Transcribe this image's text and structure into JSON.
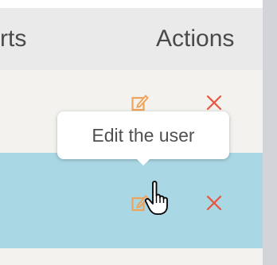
{
  "table": {
    "columns": [
      {
        "label": "rts"
      },
      {
        "label": "Actions"
      }
    ],
    "rows": [
      {
        "state": "normal",
        "actions": [
          "edit-icon",
          "delete-icon"
        ]
      },
      {
        "state": "hovered",
        "actions": [
          "edit-icon",
          "delete-icon"
        ]
      },
      {
        "state": "normal",
        "actions": []
      }
    ]
  },
  "tooltip": {
    "text": "Edit the user"
  },
  "colors": {
    "header_bg": "#eaeaea",
    "row_bg": "#f3f2ef",
    "row_hover_bg": "#a9d7e3",
    "edit_icon": "#f0a35a",
    "delete_icon": "#e8563f",
    "side_strip": "#d3d4d8"
  },
  "cursor": {
    "icon": "hand-pointer-icon"
  }
}
